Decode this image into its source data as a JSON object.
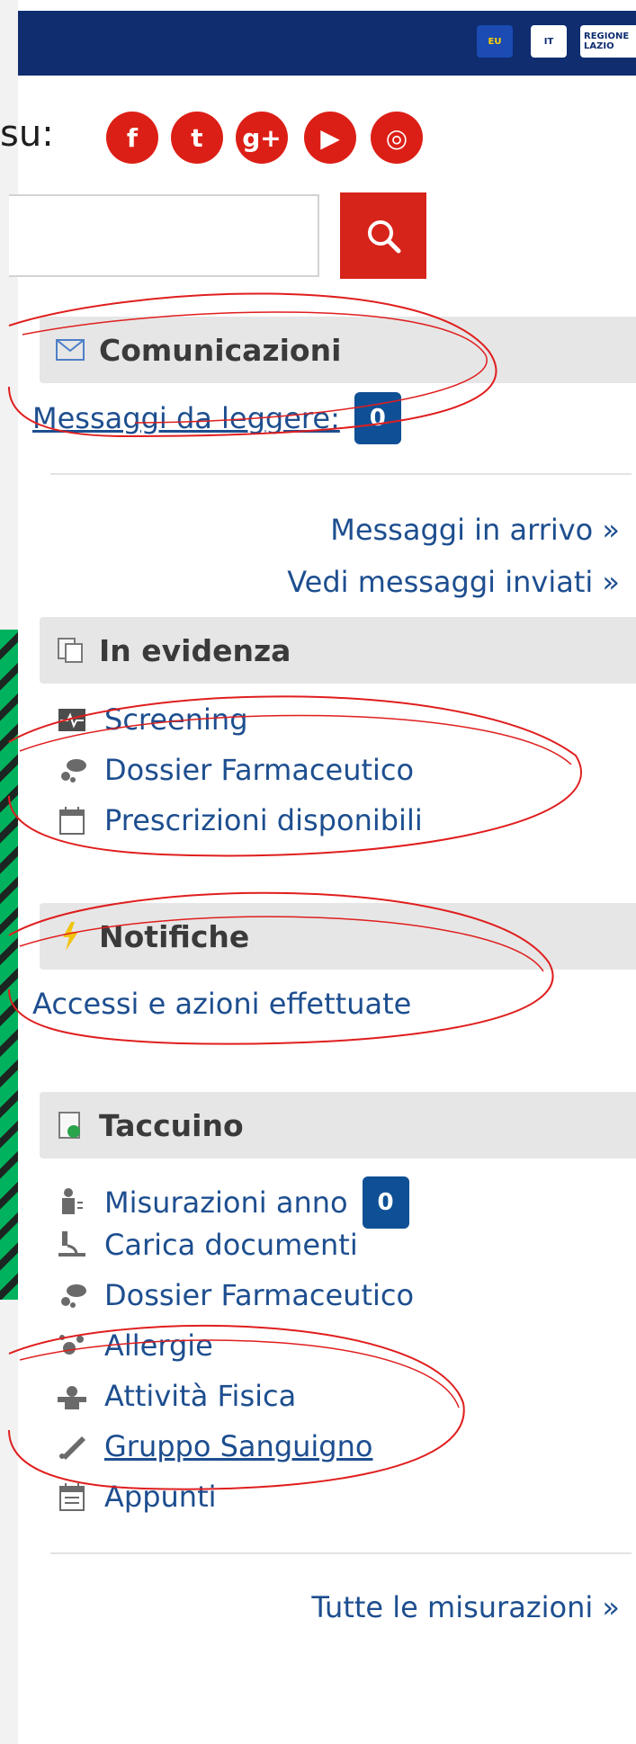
{
  "header": {
    "logos": [
      {
        "name": "eu-logo",
        "text": "EU"
      },
      {
        "name": "italy-emblem",
        "text": "IT"
      },
      {
        "name": "regione-logo",
        "text": "REGIONE LAZIO"
      }
    ]
  },
  "social": {
    "label": "su:",
    "icons": [
      {
        "name": "facebook-icon",
        "glyph": "f"
      },
      {
        "name": "twitter-icon",
        "glyph": "t"
      },
      {
        "name": "google-plus-icon",
        "glyph": "g+"
      },
      {
        "name": "youtube-icon",
        "glyph": "▶"
      },
      {
        "name": "instagram-icon",
        "glyph": "◎"
      }
    ]
  },
  "search": {
    "placeholder": "",
    "value": ""
  },
  "comunicazioni": {
    "title": "Comunicazioni",
    "messaggi_label": "Messaggi da leggere:",
    "messaggi_count": "0",
    "inbox_link": "Messaggi in arrivo »",
    "sent_link": "Vedi messaggi inviati »"
  },
  "in_evidenza": {
    "title": "In evidenza",
    "items": [
      {
        "label": "Screening",
        "icon": "screening-icon"
      },
      {
        "label": "Dossier Farmaceutico",
        "icon": "pills-icon"
      },
      {
        "label": "Prescrizioni disponibili",
        "icon": "calendar-icon"
      }
    ]
  },
  "notifiche": {
    "title": "Notifiche",
    "link": "Accessi e azioni effettuate"
  },
  "taccuino": {
    "title": "Taccuino",
    "misurazioni_label": "Misurazioni anno",
    "misurazioni_count": "0",
    "items": [
      {
        "label": "Carica documenti",
        "icon": "microscope-icon"
      },
      {
        "label": "Dossier Farmaceutico",
        "icon": "pills-icon"
      },
      {
        "label": "Allergie",
        "icon": "allergy-icon"
      },
      {
        "label": "Attività Fisica",
        "icon": "fitness-icon"
      },
      {
        "label": "Gruppo Sanguigno",
        "icon": "blood-group-icon"
      },
      {
        "label": "Appunti",
        "icon": "notes-icon"
      }
    ],
    "all_link": "Tutte le misurazioni »"
  },
  "colors": {
    "brand_navy": "#0f2d6f",
    "social_red": "#dc1f16",
    "link_blue": "#1d4e8f",
    "badge_blue": "#0f4f95",
    "section_gray": "#e6e6e6",
    "annotation_red": "#e01e1e"
  }
}
